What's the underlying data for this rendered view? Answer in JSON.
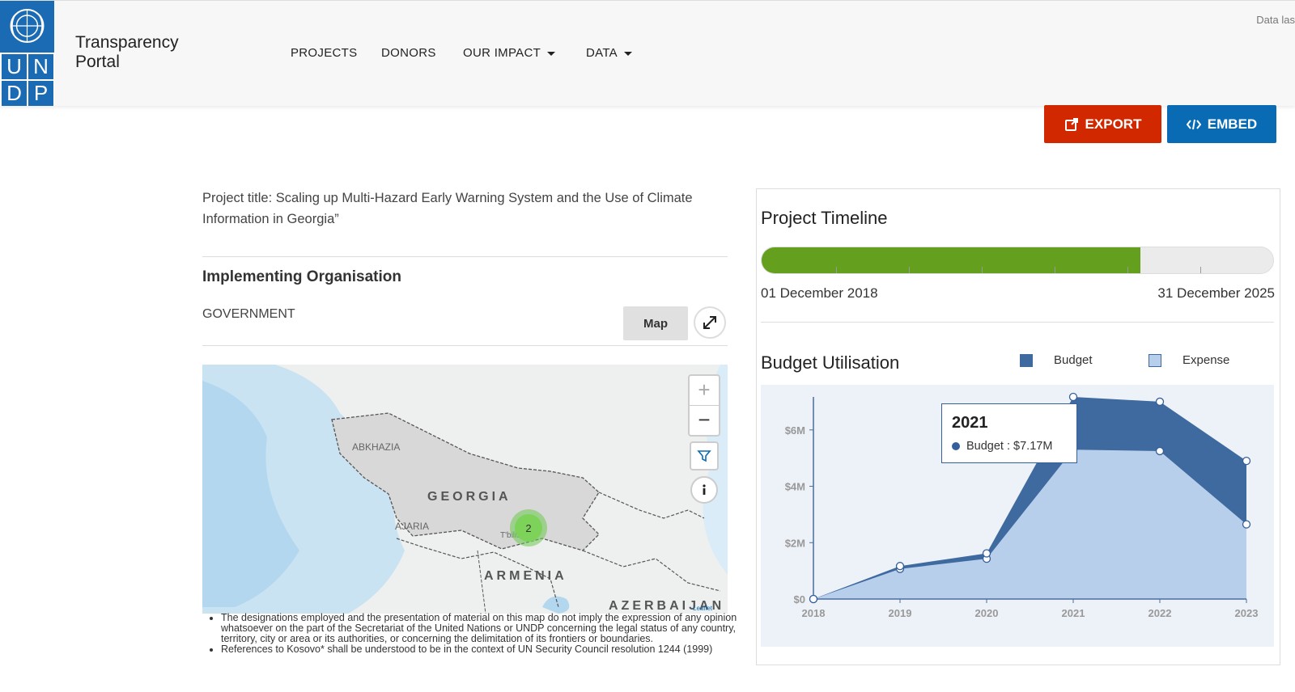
{
  "header": {
    "logo_letters": [
      "U",
      "N",
      "D",
      "P"
    ],
    "brand_line1": "Transparency",
    "brand_line2": "Portal",
    "data_last": "Data las",
    "nav": [
      {
        "label": "PROJECTS",
        "dropdown": false
      },
      {
        "label": "DONORS",
        "dropdown": false
      },
      {
        "label": "OUR IMPACT",
        "dropdown": true
      },
      {
        "label": "DATA",
        "dropdown": true
      }
    ]
  },
  "actions": {
    "export_label": "EXPORT",
    "embed_label": "EMBED",
    "export_icon": "external-link-icon",
    "embed_icon": "code-icon",
    "export_color": "#d12800",
    "embed_color": "#0a6bb5"
  },
  "project": {
    "title": "Project title: Scaling up Multi-Hazard Early Warning System and the Use of Climate Information in Georgia”",
    "implementing_heading": "Implementing Organisation",
    "implementing_value": "GOVERNMENT",
    "map_button": "Map"
  },
  "map": {
    "labels": {
      "georgia": "GEORGIA",
      "armenia": "ARMENIA",
      "azerbaijan": "AZERBAIJAN",
      "abkhazia": "ABKHAZIA",
      "ajaria": "AJARIA",
      "tbilisi": "T'bilisi"
    },
    "cluster_count": "2",
    "attribution": "Leaflet",
    "zoom_in": "+",
    "zoom_out": "−",
    "disclaimers": [
      "The designations employed and the presentation of material on this map do not imply the expression of any opinion whatsoever on the part of the Secretariat of the United Nations or UNDP concerning the legal status of any country, territory, city or area or its authorities, or concerning the delimitation of its frontiers or boundaries.",
      "References to Kosovo* shall be understood to be in the context of UN Security Council resolution 1244 (1999)"
    ]
  },
  "timeline": {
    "title": "Project Timeline",
    "start": "01 December 2018",
    "end": "31 December 2025",
    "progress": 0.74,
    "fill_color": "#64a01e"
  },
  "budget": {
    "title": "Budget Utilisation",
    "legend_budget": "Budget",
    "legend_expense": "Expense",
    "tooltip_year": "2021",
    "tooltip_value": "Budget : $7.17M"
  },
  "chart_data": {
    "type": "area",
    "title": "Budget Utilisation",
    "x": [
      "2018",
      "2019",
      "2020",
      "2021",
      "2022",
      "2023"
    ],
    "series": [
      {
        "name": "Budget",
        "values": [
          0,
          1.17,
          1.62,
          7.17,
          7.0,
          4.9
        ],
        "color": "#3e6aa0"
      },
      {
        "name": "Expense",
        "values": [
          0,
          1.07,
          1.43,
          5.3,
          5.25,
          2.65
        ],
        "color": "#b8cfec"
      }
    ],
    "yticks": [
      "$0",
      "$2M",
      "$4M",
      "$6M"
    ],
    "ylim": [
      0,
      7.17
    ],
    "ylabel": "",
    "xlabel": "",
    "legend": "top"
  }
}
